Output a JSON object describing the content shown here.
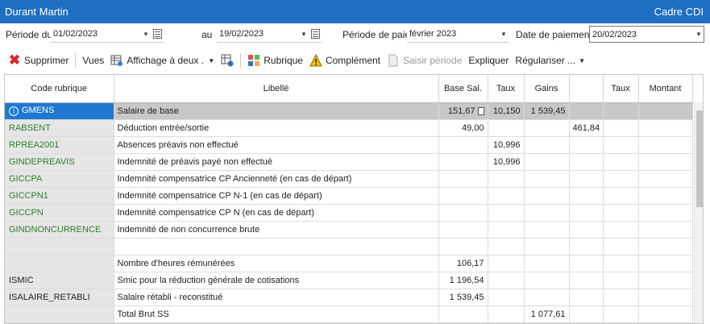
{
  "window": {
    "title": "Durant Martin",
    "contract": "Cadre CDI"
  },
  "filters": {
    "period_from_label": "Période du",
    "period_from": "01/02/2023",
    "period_to_label": "au",
    "period_to": "19/02/2023",
    "pay_period_label": "Période de paie",
    "pay_period": "février 2023",
    "pay_date_label": "Date de paiement",
    "pay_date": "20/02/2023"
  },
  "toolbar": {
    "delete": "Supprimer",
    "views": "Vues",
    "view_mode": "Affichage à deux ...",
    "rubric": "Rubrique",
    "complement": "Complément",
    "enter_period": "Saisir période",
    "explain": "Expliquer",
    "regularize": "Régulariser ..."
  },
  "columns": [
    "Code rubrique",
    "Libellé",
    "Base Sal.",
    "Taux",
    "Gains",
    "",
    "Taux",
    "Montant"
  ],
  "rows": [
    {
      "code": "GMENS",
      "label": "Salaire de base",
      "base": "151,67",
      "taux": "10,150",
      "gains": "1 539,45",
      "deduc": "",
      "taux2": "",
      "montant": ""
    },
    {
      "code": "RABSENT",
      "label": "Déduction entrée/sortie",
      "base": "49,00",
      "taux": "",
      "gains": "",
      "deduc": "461,84",
      "taux2": "",
      "montant": ""
    },
    {
      "code": "RPREA2001",
      "label": "Absences préavis non effectué",
      "base": "",
      "taux": "10,996",
      "gains": "",
      "deduc": "",
      "taux2": "",
      "montant": ""
    },
    {
      "code": "GINDEPREAVIS",
      "label": "Indemnité de préavis payé non effectué",
      "base": "",
      "taux": "10,996",
      "gains": "",
      "deduc": "",
      "taux2": "",
      "montant": ""
    },
    {
      "code": "GICCPA",
      "label": "Indemnité compensatrice CP Ancienneté (en cas de départ)",
      "base": "",
      "taux": "",
      "gains": "",
      "deduc": "",
      "taux2": "",
      "montant": ""
    },
    {
      "code": "GICCPN1",
      "label": "Indemnité compensatrice CP N-1 (en cas de départ)",
      "base": "",
      "taux": "",
      "gains": "",
      "deduc": "",
      "taux2": "",
      "montant": ""
    },
    {
      "code": "GICCPN",
      "label": "Indemnité compensatrice CP N (en cas de départ)",
      "base": "",
      "taux": "",
      "gains": "",
      "deduc": "",
      "taux2": "",
      "montant": ""
    },
    {
      "code": "GINDNONCURRENCE",
      "label": "Indemnité de non concurrence brute",
      "base": "",
      "taux": "",
      "gains": "",
      "deduc": "",
      "taux2": "",
      "montant": ""
    },
    {
      "code": "",
      "label": "",
      "base": "",
      "taux": "",
      "gains": "",
      "deduc": "",
      "taux2": "",
      "montant": ""
    },
    {
      "code": "",
      "label": "Nombre d'heures rémunérées",
      "base": "106,17",
      "taux": "",
      "gains": "",
      "deduc": "",
      "taux2": "",
      "montant": ""
    },
    {
      "code": "ISMIC",
      "label": "Smic pour la réduction générale de cotisations",
      "base": "1 196,54",
      "taux": "",
      "gains": "",
      "deduc": "",
      "taux2": "",
      "montant": ""
    },
    {
      "code": "ISALAIRE_RETABLI",
      "label": "Salaire rétabli - reconstitué",
      "base": "1 539,45",
      "taux": "",
      "gains": "",
      "deduc": "",
      "taux2": "",
      "montant": ""
    },
    {
      "code": "",
      "label": "Total Brut SS",
      "base": "",
      "taux": "",
      "gains": "1 077,61",
      "deduc": "",
      "taux2": "",
      "montant": ""
    }
  ]
}
